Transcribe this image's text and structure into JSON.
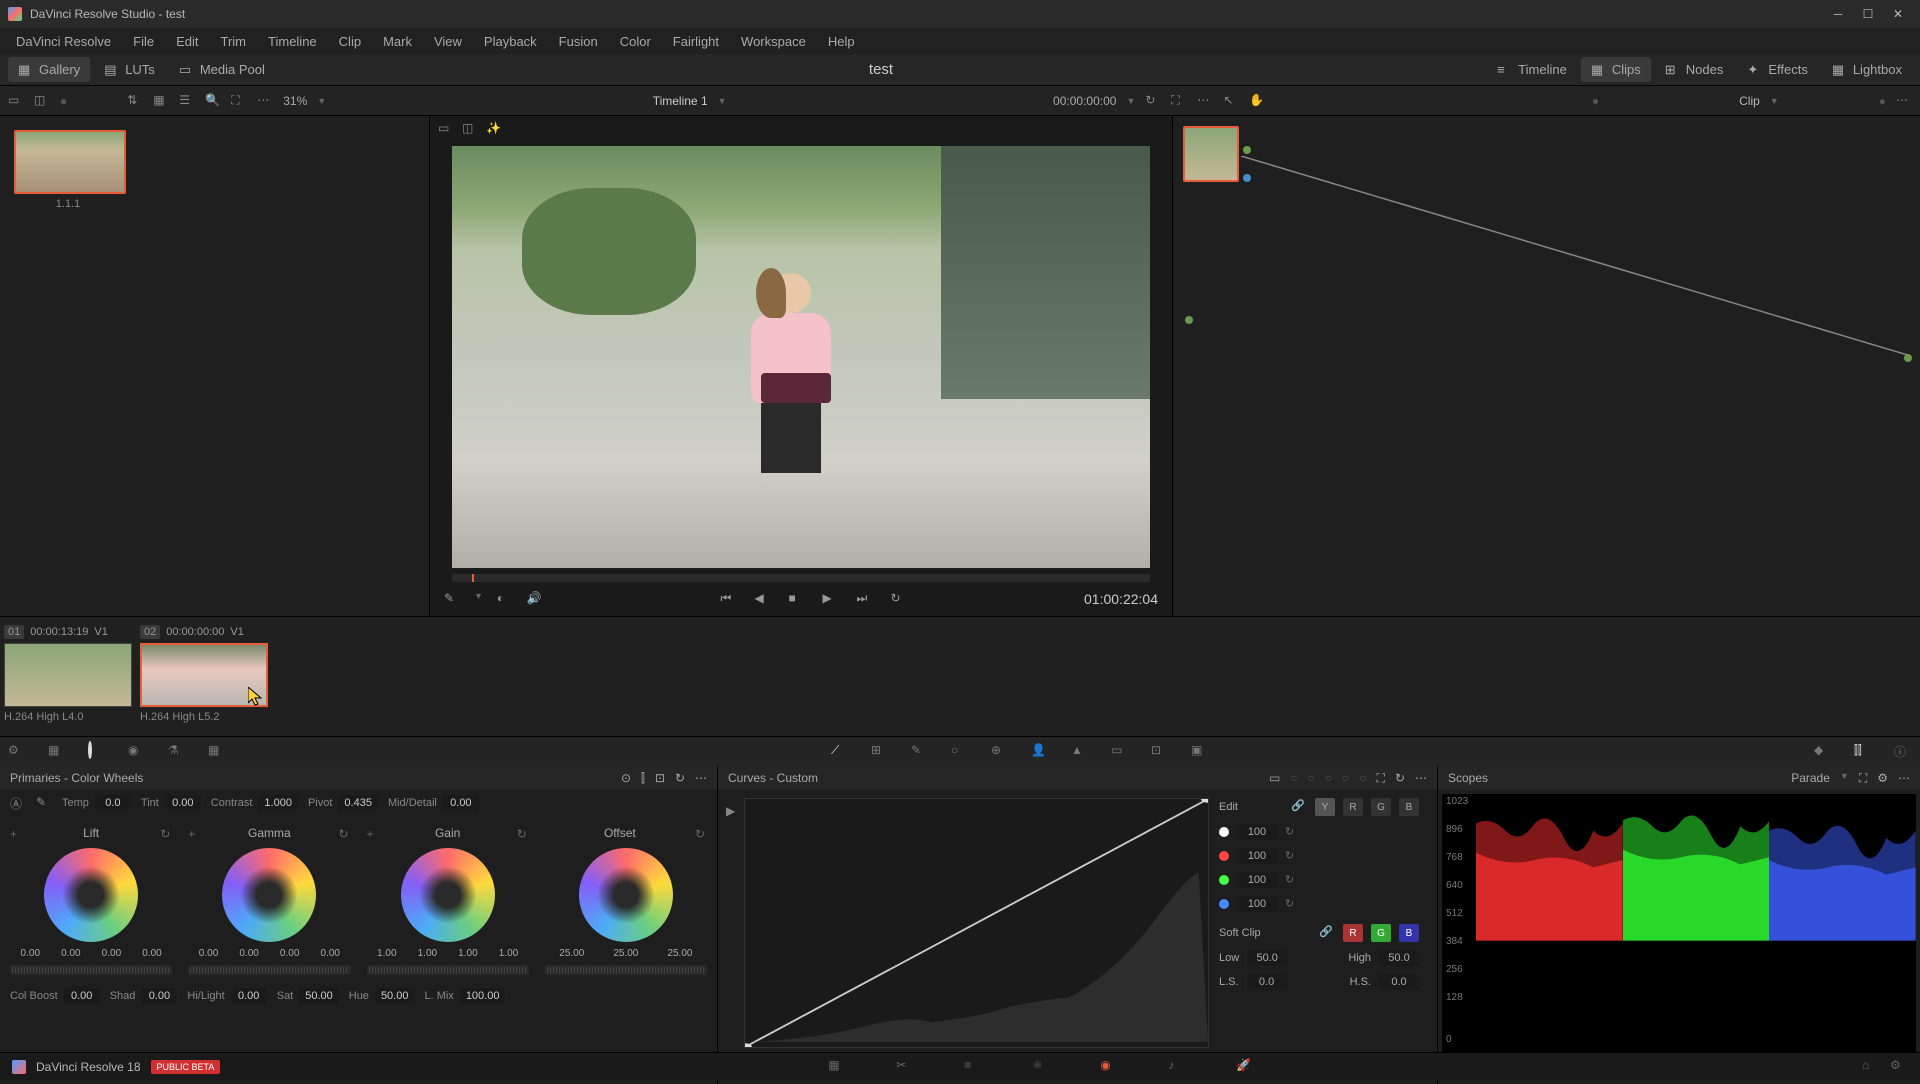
{
  "titlebar": {
    "title": "DaVinci Resolve Studio - test"
  },
  "menu": [
    "DaVinci Resolve",
    "File",
    "Edit",
    "Trim",
    "Timeline",
    "Clip",
    "Mark",
    "View",
    "Playback",
    "Fusion",
    "Color",
    "Fairlight",
    "Workspace",
    "Help"
  ],
  "workspace": {
    "left": [
      {
        "label": "Gallery",
        "active": true,
        "icon": "image"
      },
      {
        "label": "LUTs",
        "icon": "grid"
      },
      {
        "label": "Media Pool",
        "icon": "folder"
      }
    ],
    "project": "test",
    "right": [
      {
        "label": "Timeline",
        "icon": "timeline"
      },
      {
        "label": "Clips",
        "active": true,
        "icon": "clips"
      },
      {
        "label": "Nodes",
        "icon": "nodes"
      },
      {
        "label": "Effects",
        "icon": "fx"
      },
      {
        "label": "Lightbox",
        "icon": "grid"
      }
    ]
  },
  "toolbar": {
    "zoom": "31%",
    "timeline": "Timeline 1",
    "timecode": "00:00:00:00",
    "right_mode": "Clip"
  },
  "gallery": {
    "thumb_label": "1.1.1"
  },
  "viewer": {
    "timecode": "01:00:22:04"
  },
  "clips": [
    {
      "num": "01",
      "tc": "00:00:13:19",
      "track": "V1",
      "label": "H.264 High L4.0",
      "selected": false
    },
    {
      "num": "02",
      "tc": "00:00:00:00",
      "track": "V1",
      "label": "H.264 High L5.2",
      "selected": true
    }
  ],
  "primaries": {
    "title": "Primaries - Color Wheels",
    "adjustments": [
      {
        "label": "Temp",
        "val": "0.0"
      },
      {
        "label": "Tint",
        "val": "0.00"
      },
      {
        "label": "Contrast",
        "val": "1.000"
      },
      {
        "label": "Pivot",
        "val": "0.435"
      },
      {
        "label": "Mid/Detail",
        "val": "0.00"
      }
    ],
    "wheels": [
      {
        "name": "Lift",
        "vals": [
          "0.00",
          "0.00",
          "0.00",
          "0.00"
        ]
      },
      {
        "name": "Gamma",
        "vals": [
          "0.00",
          "0.00",
          "0.00",
          "0.00"
        ]
      },
      {
        "name": "Gain",
        "vals": [
          "1.00",
          "1.00",
          "1.00",
          "1.00"
        ]
      },
      {
        "name": "Offset",
        "vals": [
          "25.00",
          "25.00",
          "25.00"
        ]
      }
    ],
    "bottom": [
      {
        "label": "Col Boost",
        "val": "0.00"
      },
      {
        "label": "Shad",
        "val": "0.00"
      },
      {
        "label": "Hi/Light",
        "val": "0.00"
      },
      {
        "label": "Sat",
        "val": "50.00"
      },
      {
        "label": "Hue",
        "val": "50.00"
      },
      {
        "label": "L. Mix",
        "val": "100.00"
      }
    ]
  },
  "curves": {
    "title": "Curves - Custom",
    "edit_label": "Edit",
    "channels": [
      "Y",
      "R",
      "G",
      "B"
    ],
    "intensity": [
      {
        "color": "#fff",
        "val": "100"
      },
      {
        "color": "#ff4444",
        "val": "100"
      },
      {
        "color": "#44ff44",
        "val": "100"
      },
      {
        "color": "#4488ff",
        "val": "100"
      }
    ],
    "softclip": {
      "label": "Soft Clip",
      "low": {
        "label": "Low",
        "val": "50.0"
      },
      "high": {
        "label": "High",
        "val": "50.0"
      },
      "ls": {
        "label": "L.S.",
        "val": "0.0"
      },
      "hs": {
        "label": "H.S.",
        "val": "0.0"
      }
    }
  },
  "scopes": {
    "title": "Scopes",
    "mode": "Parade",
    "ticks": [
      "1023",
      "896",
      "768",
      "640",
      "512",
      "384",
      "256",
      "128",
      "0"
    ]
  },
  "footer": {
    "app": "DaVinci Resolve 18",
    "badge": "PUBLIC BETA"
  }
}
